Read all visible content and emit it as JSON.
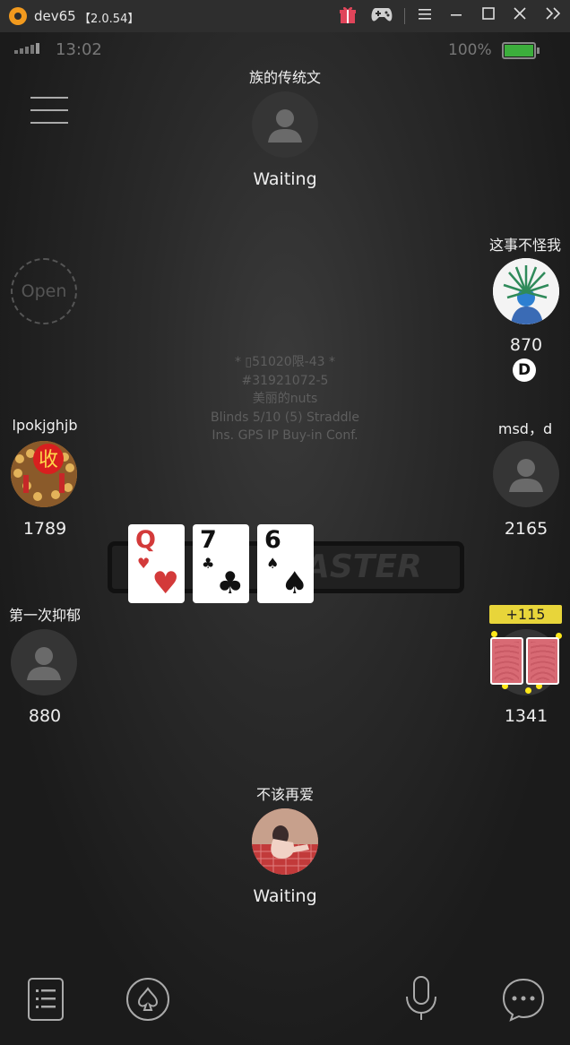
{
  "window": {
    "title": "dev65",
    "version": "【2.0.54】"
  },
  "status": {
    "time": "13:02",
    "battery": "100%"
  },
  "open_label": "Open",
  "table_info": {
    "line1": "* ▯51020限-43 *",
    "line2": "#31921072-5",
    "line3": "美丽的nuts",
    "line4": "Blinds 5/10 (5) Straddle",
    "line5": "Ins. GPS IP Buy-in Conf."
  },
  "seats": {
    "top": {
      "name": "族的传统文",
      "status": "Waiting"
    },
    "right_top": {
      "name": "这事不怪我",
      "chips": "870",
      "dealer": "D"
    },
    "left_mid": {
      "name": "lpokjghjb",
      "chips": "1789",
      "avatar_text": "收"
    },
    "right_mid": {
      "name": "msd，d",
      "chips": "2165"
    },
    "left_low": {
      "name": "第一次抑郁",
      "chips": "880"
    },
    "right_low": {
      "chips": "1341",
      "win": "+115"
    },
    "bottom": {
      "name": "不该再爱",
      "status": "Waiting"
    }
  },
  "board": [
    {
      "rank": "Q",
      "suit": "♥",
      "color": "#d33a3a"
    },
    {
      "rank": "7",
      "suit": "♣",
      "color": "#111111"
    },
    {
      "rank": "6",
      "suit": "♠",
      "color": "#111111"
    }
  ],
  "watermark": "ASTER",
  "icons": {
    "menu": "hamburger-menu-icon",
    "history": "hand-history-icon",
    "spade": "spade-icon",
    "mic": "microphone-icon",
    "chat": "chat-bubble-icon"
  },
  "colors": {
    "accent_win": "#e8d53a",
    "card_back": "#d86a74"
  }
}
